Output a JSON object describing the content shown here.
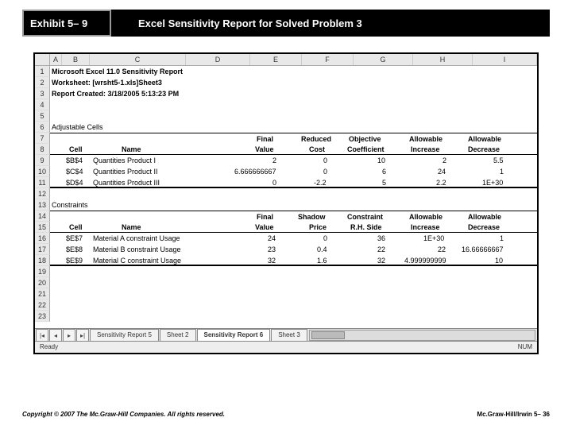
{
  "header": {
    "exhibit": "Exhibit 5– 9",
    "title": "Excel Sensitivity Report for Solved Problem 3"
  },
  "columns": [
    "A",
    "B",
    "C",
    "D",
    "E",
    "F",
    "G",
    "H",
    "I"
  ],
  "rows_visible": [
    "1",
    "2",
    "3",
    "4",
    "5",
    "6",
    "7",
    "8",
    "9",
    "10",
    "11",
    "12",
    "13",
    "14",
    "15",
    "16",
    "17",
    "18",
    "19",
    "20",
    "21",
    "22",
    "23"
  ],
  "report": {
    "line1": "Microsoft Excel 11.0 Sensitivity Report",
    "line2": "Worksheet: [wrsht5-1.xls]Sheet3",
    "line3": "Report Created: 3/18/2005 5:13:23 PM"
  },
  "section1": {
    "title": "Adjustable Cells",
    "head": {
      "cell": "Cell",
      "name": "Name",
      "c1a": "Final",
      "c1b": "Value",
      "c2a": "Reduced",
      "c2b": "Cost",
      "c3a": "Objective",
      "c3b": "Coefficient",
      "c4a": "Allowable",
      "c4b": "Increase",
      "c5a": "Allowable",
      "c5b": "Decrease"
    },
    "rows": [
      {
        "cell": "$B$4",
        "name": "Quantities Product I",
        "v": "2",
        "r": "0",
        "o": "10",
        "ai": "2",
        "ad": "5.5"
      },
      {
        "cell": "$C$4",
        "name": "Quantities Product II",
        "v": "6.666666667",
        "r": "0",
        "o": "6",
        "ai": "24",
        "ad": "1"
      },
      {
        "cell": "$D$4",
        "name": "Quantities Product III",
        "v": "0",
        "r": "-2.2",
        "o": "5",
        "ai": "2.2",
        "ad": "1E+30"
      }
    ]
  },
  "section2": {
    "title": "Constraints",
    "head": {
      "cell": "Cell",
      "name": "Name",
      "c1a": "Final",
      "c1b": "Value",
      "c2a": "Shadow",
      "c2b": "Price",
      "c3a": "Constraint",
      "c3b": "R.H. Side",
      "c4a": "Allowable",
      "c4b": "Increase",
      "c5a": "Allowable",
      "c5b": "Decrease"
    },
    "rows": [
      {
        "cell": "$E$7",
        "name": "Material A constraint Usage",
        "v": "24",
        "r": "0",
        "o": "36",
        "ai": "1E+30",
        "ad": "1"
      },
      {
        "cell": "$E$8",
        "name": "Material B constraint Usage",
        "v": "23",
        "r": "0.4",
        "o": "22",
        "ai": "22",
        "ad": "16.66666667"
      },
      {
        "cell": "$E$9",
        "name": "Material C constraint Usage",
        "v": "32",
        "r": "1.6",
        "o": "32",
        "ai": "4.999999999",
        "ad": "10"
      }
    ]
  },
  "tabs": {
    "t1": "Sensitivity Report 5",
    "t2": "Sheet 2",
    "t3": "Sensitivity Report 6",
    "t4": "Sheet 3"
  },
  "status": {
    "left": "Ready",
    "right": "NUM"
  },
  "footer": {
    "left": "Copyright © 2007 The Mc.Graw-Hill Companies. All rights reserved.",
    "right": "Mc.Graw-Hill/Irwin   5– 36"
  }
}
